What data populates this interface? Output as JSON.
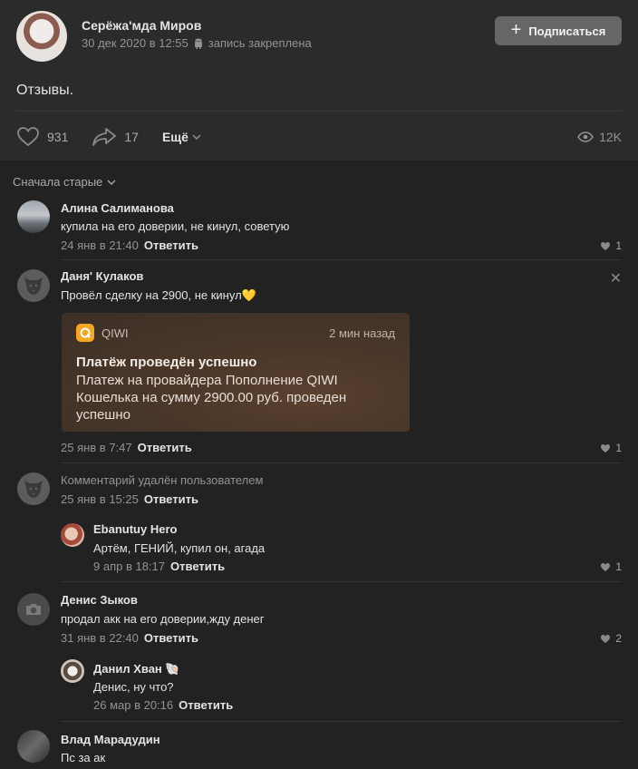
{
  "post": {
    "author": "Серёжа'мда Миров",
    "date": "30 дек 2020 в 12:55",
    "pinned": "запись закреплена",
    "subscribe_label": "Подписаться",
    "text": "Отзывы.",
    "likes": "931",
    "shares": "17",
    "more_label": "Ещё",
    "views": "12K"
  },
  "comments_sort": "Сначала старые",
  "comments": [
    {
      "name": "Алина Салиманова",
      "text": "купила на его доверии, не кинул, советую",
      "date": "24 янв в 21:40",
      "reply": "Ответить",
      "likes": "1"
    },
    {
      "name": "Даня' Кулаков",
      "text": "Провёл сделку на 2900, не кинул💛",
      "date": "25 янв в 7:47",
      "reply": "Ответить",
      "likes": "1",
      "attachment": {
        "app": "QIWI",
        "time": "2 мин назад",
        "title": "Платёж проведён успешно",
        "body": "Платеж на провайдера Пополнение QIWI\nКошелька на сумму 2900.00 руб. проведен\nуспешно"
      }
    },
    {
      "name": "",
      "text": "Комментарий удалён пользователем",
      "date": "25 янв в 15:25",
      "reply": "Ответить"
    },
    {
      "name": "Ebanutuy Hero",
      "text": "Артём, ГЕНИЙ, купил он, агада",
      "date": "9 апр в 18:17",
      "reply": "Ответить",
      "likes": "1"
    },
    {
      "name": "Денис Зыков",
      "text": "продал акк на его доверии,жду денег",
      "date": "31 янв в 22:40",
      "reply": "Ответить",
      "likes": "2"
    },
    {
      "name": "Данил Хван 🐚",
      "text": "Денис, ну что?",
      "date": "26 мар в 20:16",
      "reply": "Ответить"
    },
    {
      "name": "Влад Марадудин",
      "text": "Пс за ак"
    }
  ],
  "colors": {
    "background": "#222222",
    "panel": "#2b2b2b",
    "button": "#666666",
    "accent_qiwi": "#f5a623"
  }
}
